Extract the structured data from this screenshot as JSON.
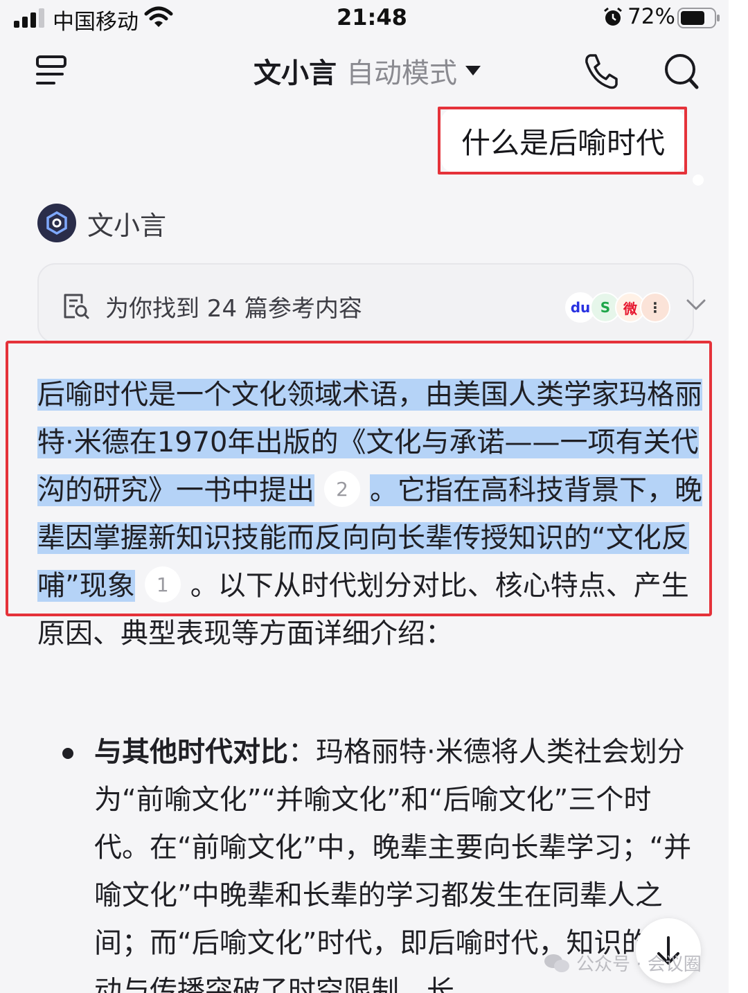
{
  "status_bar": {
    "carrier": "中国移动",
    "time": "21:48",
    "battery": "72%"
  },
  "nav": {
    "app_name": "文小言",
    "mode": "自动模式"
  },
  "user_message": "什么是后喻时代",
  "assistant": {
    "name": "文小言"
  },
  "references": {
    "label": "为你找到 24 篇参考内容",
    "sources": [
      "baidu-icon",
      "green-source-icon",
      "weibo-icon",
      "more-icon"
    ]
  },
  "answer": {
    "hl_1": "后喻时代是一个文化领域术语，由美国人类学家玛格丽特·米德在1970年出版的《文化与承诺——一项有关代沟的研究》一书中提出",
    "cite_1": "2",
    "hl_2a": "。它指在高科技背景下，晚辈因掌握新知识技能而反向向长辈传授知识的“文化反哺”现",
    "hl_2b": "象",
    "cite_2": "1",
    "rest": "。以下从时代划分对比、核心特点、产生原因、典型表现等方面详细介绍："
  },
  "bullet": {
    "label": "与其他时代对比",
    "text": "：玛格丽特·米德将人类社会划分为“前喻文化”“并喻文化”和“后喻文化”三个时代。在“前喻文化”中，晚辈主要向长辈学习；“并喻文化”中晚辈和长辈的学习都发生在同辈人之间；而“后喻文化”时代，即后喻时代，知识的流动与传播突破了时空限制，长"
  },
  "watermark": "公众号 · 会议圈",
  "colors": {
    "highlight": "#b5d3f7",
    "annotation_red": "#e5323a",
    "background": "#f5f5f7"
  }
}
